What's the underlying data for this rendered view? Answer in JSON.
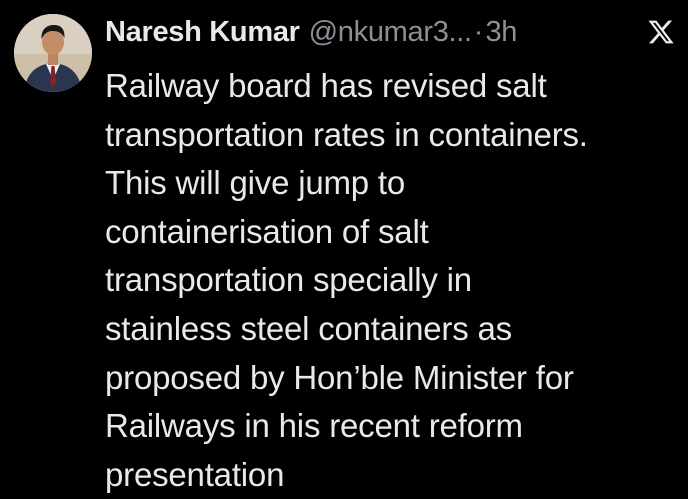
{
  "tweet": {
    "author_name": "Naresh Kumar",
    "handle": "@nkumar3...",
    "separator": "·",
    "timestamp": "3h",
    "avatar_icon": "profile-photo",
    "platform_icon": "x-logo-icon",
    "text": "Railway board has revised salt\ntransportation rates in containers.\nThis will give jump to\ncontainerisation of salt\ntransportation specially in\nstainless steel containers as\nproposed by Hon’ble Minister for\nRailways in his recent reform\npresentation"
  },
  "colors": {
    "background": "#000000",
    "primary_text": "#e7e9ea",
    "secondary_text": "#8b9097"
  }
}
